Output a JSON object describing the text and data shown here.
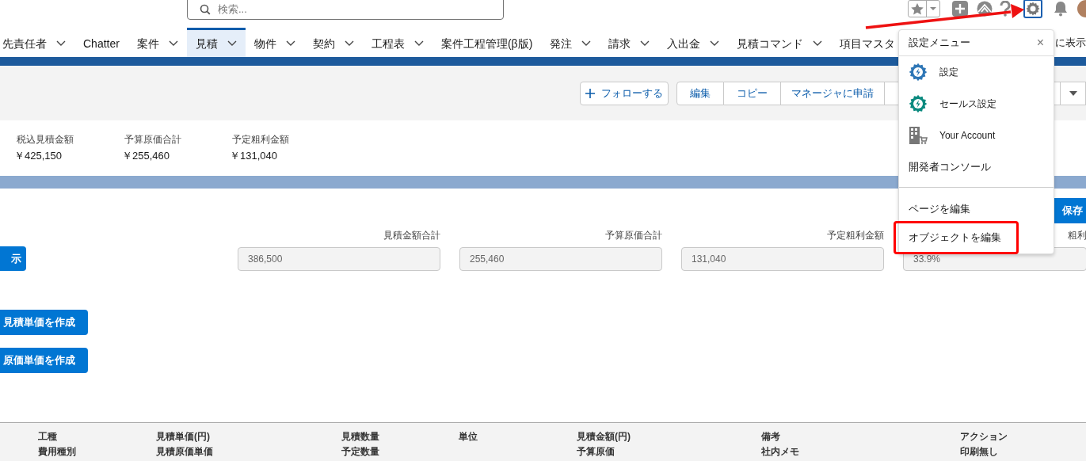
{
  "search": {
    "placeholder": "検索..."
  },
  "nav": {
    "items": [
      {
        "label": "先責任者",
        "dropdown": true,
        "selected": false
      },
      {
        "label": "Chatter",
        "dropdown": false,
        "selected": false
      },
      {
        "label": "案件",
        "dropdown": true,
        "selected": false
      },
      {
        "label": "見積",
        "dropdown": true,
        "selected": true
      },
      {
        "label": "物件",
        "dropdown": true,
        "selected": false
      },
      {
        "label": "契約",
        "dropdown": true,
        "selected": false
      },
      {
        "label": "工程表",
        "dropdown": true,
        "selected": false
      },
      {
        "label": "案件工程管理(β版)",
        "dropdown": false,
        "selected": false
      },
      {
        "label": "発注",
        "dropdown": true,
        "selected": false
      },
      {
        "label": "請求",
        "dropdown": true,
        "selected": false
      },
      {
        "label": "入出金",
        "dropdown": true,
        "selected": false
      },
      {
        "label": "見積コマンド",
        "dropdown": true,
        "selected": false
      },
      {
        "label": "項目マスタ",
        "dropdown": false,
        "selected": false
      }
    ],
    "more": "に表示"
  },
  "actions": {
    "follow": "フォローする",
    "buttons": [
      "編集",
      "コピー",
      "マネージャに申請"
    ]
  },
  "highlights": [
    {
      "label": "税込見積金額",
      "value": "￥425,150"
    },
    {
      "label": "予算原価合計",
      "value": "￥255,460"
    },
    {
      "label": "予定粗利金額",
      "value": "￥131,040"
    }
  ],
  "save_button": "保存",
  "show_button": "示",
  "totals": [
    {
      "label": "見積金額合計",
      "value": "386,500"
    },
    {
      "label": "予算原価合計",
      "value": "255,460"
    },
    {
      "label": "予定粗利金額",
      "value": "131,040"
    },
    {
      "label": "粗利",
      "value": "33.9%"
    }
  ],
  "create_buttons": [
    "見積単価を作成",
    "原価単価を作成"
  ],
  "table": {
    "columns": [
      {
        "top": "工種",
        "bottom": "費用種別"
      },
      {
        "top": "見積単価(円)",
        "bottom": "見積原価単価"
      },
      {
        "top": "見積数量",
        "bottom": "予定数量"
      },
      {
        "top": "単位"
      },
      {
        "top": "見積金額(円)",
        "bottom": "予算原価"
      },
      {
        "top": "備考",
        "bottom": "社内メモ"
      },
      {
        "top": "アクション",
        "bottom": "印刷無し"
      }
    ]
  },
  "setup_menu": {
    "title": "設定メニュー",
    "close": "×",
    "items": [
      {
        "label": "設定",
        "kind": "gear",
        "color": "#2e76b6",
        "highlighted": false
      },
      {
        "label": "セールス設定",
        "kind": "gear",
        "color": "#0b8a7f",
        "highlighted": false
      },
      {
        "label": "Your Account",
        "kind": "building",
        "highlighted": false
      },
      {
        "label": "開発者コンソール",
        "kind": "text",
        "highlighted": false
      },
      {
        "label": "ページを編集",
        "kind": "text",
        "divider_before": true,
        "highlighted": false
      },
      {
        "label": "オブジェクトを編集",
        "kind": "text",
        "highlighted": true
      }
    ]
  }
}
